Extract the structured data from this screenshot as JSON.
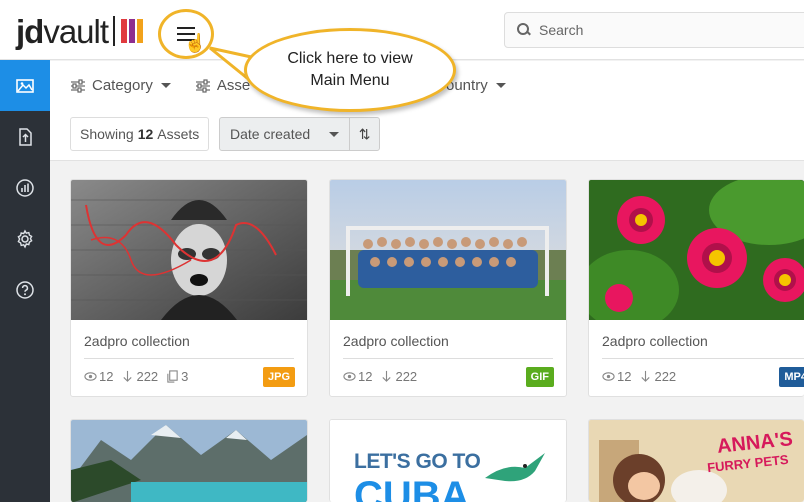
{
  "header": {
    "logo": {
      "text_bold": "jd",
      "text_regular": "vault"
    },
    "menu_button": {
      "icon": "hamburger-icon"
    },
    "search": {
      "placeholder": "Search",
      "icon": "search-icon"
    }
  },
  "callout": {
    "line1": "Click here to view",
    "line2": "Main Menu"
  },
  "sidebar": {
    "items": [
      {
        "icon": "images-icon",
        "active": true
      },
      {
        "icon": "upload-icon",
        "active": false
      },
      {
        "icon": "analytics-icon",
        "active": false
      },
      {
        "icon": "gear-icon",
        "active": false
      },
      {
        "icon": "help-icon",
        "active": false
      }
    ]
  },
  "filters": {
    "category": "Category",
    "assets_partial": "Asse",
    "country_partial": "ountry"
  },
  "toolbar": {
    "showing_prefix": "Showing",
    "showing_count": "12",
    "showing_suffix": "Assets",
    "sort_label": "Date created",
    "sort_direction_icon": "⇅"
  },
  "cards": [
    {
      "title": "2adpro collection",
      "views": "12",
      "downloads": "222",
      "copies": "3",
      "badge": "JPG",
      "badge_color": "#f39c12"
    },
    {
      "title": "2adpro collection",
      "views": "12",
      "downloads": "222",
      "copies": "",
      "badge": "GIF",
      "badge_color": "#5aac1e"
    },
    {
      "title": "2adpro collection",
      "views": "12",
      "downloads": "222",
      "copies": "",
      "badge": "MP4",
      "badge_color": "#1f5c99"
    }
  ],
  "second_row_text": {
    "cuba_line1": "LET'S GO TO",
    "cuba_line2": "CUBA",
    "anna_line1": "ANNA'S",
    "anna_line2": "FURRY PETS"
  },
  "colors": {
    "accent": "#1d8ee6",
    "sidebar": "#2c3138",
    "highlight": "#f0b429"
  }
}
